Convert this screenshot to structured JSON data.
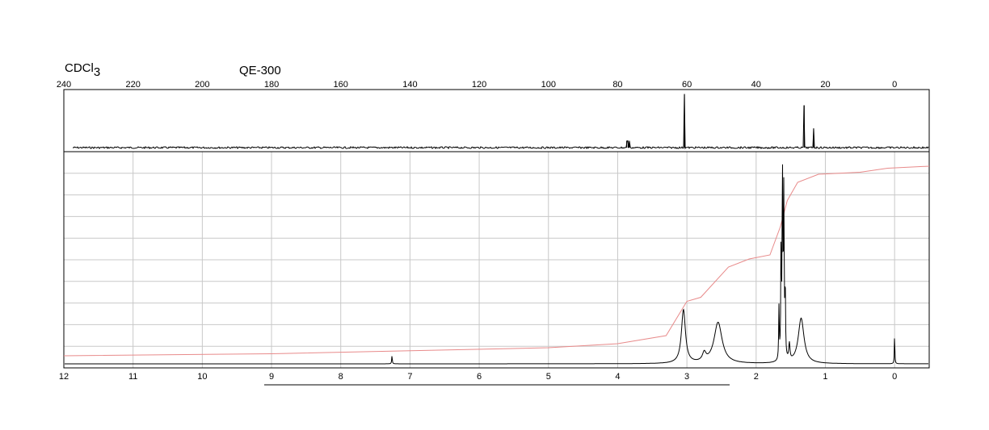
{
  "chart_data": [
    {
      "type": "line",
      "label_prefix": "CDCl",
      "label_subscript": "3",
      "instrument": "QE-300",
      "xlim": [
        240,
        -10
      ],
      "x_ticks": [
        "240",
        "220",
        "200",
        "180",
        "160",
        "140",
        "120",
        "100",
        "80",
        "60",
        "40",
        "20",
        "0"
      ],
      "peaks_x": [
        77.4,
        77.0,
        76.6,
        60.7,
        26.1,
        23.4
      ],
      "peaks_height": [
        0.12,
        0.12,
        0.12,
        0.95,
        0.75,
        0.34
      ],
      "baseline_noise": 0.015
    },
    {
      "type": "line",
      "xlim": [
        12,
        -0.5
      ],
      "x_ticks": [
        "12",
        "11",
        "10",
        "9",
        "8",
        "7",
        "6",
        "5",
        "4",
        "3",
        "2",
        "1",
        "0"
      ],
      "grid": true,
      "peaks": [
        {
          "x": 7.26,
          "h": 0.04,
          "w": 0.005
        },
        {
          "x": 3.05,
          "h": 0.26,
          "w": 0.035
        },
        {
          "x": 2.75,
          "h": 0.04,
          "w": 0.03
        },
        {
          "x": 2.55,
          "h": 0.2,
          "w": 0.07
        },
        {
          "x": 1.67,
          "h": 0.26,
          "w": 0.005
        },
        {
          "x": 1.64,
          "h": 0.55,
          "w": 0.005
        },
        {
          "x": 1.62,
          "h": 0.92,
          "w": 0.006
        },
        {
          "x": 1.6,
          "h": 0.8,
          "w": 0.006
        },
        {
          "x": 1.58,
          "h": 0.35,
          "w": 0.005
        },
        {
          "x": 1.52,
          "h": 0.08,
          "w": 0.01
        },
        {
          "x": 1.35,
          "h": 0.22,
          "w": 0.05
        },
        {
          "x": 0.0,
          "h": 0.15,
          "w": 0.004
        }
      ],
      "integral": [
        [
          12.0,
          0.02
        ],
        [
          9.0,
          0.03
        ],
        [
          7.0,
          0.045
        ],
        [
          5.0,
          0.06
        ],
        [
          4.0,
          0.08
        ],
        [
          3.3,
          0.12
        ],
        [
          3.0,
          0.29
        ],
        [
          2.8,
          0.31
        ],
        [
          2.4,
          0.46
        ],
        [
          2.1,
          0.5
        ],
        [
          1.8,
          0.52
        ],
        [
          1.65,
          0.66
        ],
        [
          1.55,
          0.79
        ],
        [
          1.4,
          0.88
        ],
        [
          1.1,
          0.92
        ],
        [
          0.5,
          0.93
        ],
        [
          0.1,
          0.95
        ],
        [
          -0.5,
          0.96
        ]
      ],
      "integral_color": "#e88a8a"
    }
  ]
}
